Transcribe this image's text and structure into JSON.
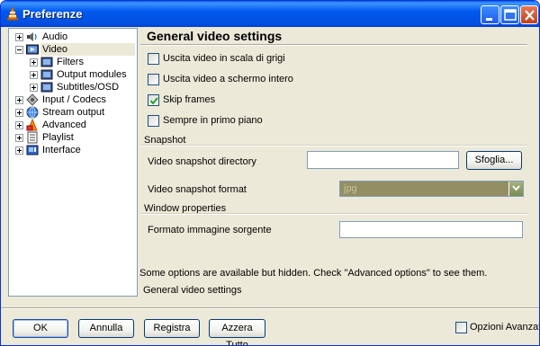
{
  "window": {
    "title": "Preferenze"
  },
  "tree": {
    "items": [
      {
        "label": "Audio",
        "icon": "speaker-icon",
        "expander": "plus"
      },
      {
        "label": "Video",
        "icon": "video-icon",
        "expander": "minus",
        "selected": true
      },
      {
        "label": "Filters",
        "icon": "film-icon",
        "expander": "plus",
        "child": true
      },
      {
        "label": "Output modules",
        "icon": "film-icon",
        "expander": "plus",
        "child": true
      },
      {
        "label": "Subtitles/OSD",
        "icon": "film-icon",
        "expander": "plus",
        "child": true
      },
      {
        "label": "Input / Codecs",
        "icon": "codecs-icon",
        "expander": "plus"
      },
      {
        "label": "Stream output",
        "icon": "stream-globe-icon",
        "expander": "plus"
      },
      {
        "label": "Advanced",
        "icon": "advanced-icon",
        "expander": "plus"
      },
      {
        "label": "Playlist",
        "icon": "playlist-icon",
        "expander": "plus"
      },
      {
        "label": "Interface",
        "icon": "interface-icon",
        "expander": "plus"
      }
    ]
  },
  "panel": {
    "title": "General video settings",
    "checkboxes": [
      {
        "label": "Uscita video in scala di grigi",
        "checked": false
      },
      {
        "label": "Uscita video a schermo intero",
        "checked": false
      },
      {
        "label": "Skip frames",
        "checked": true
      },
      {
        "label": "Sempre in primo piano",
        "checked": false
      }
    ],
    "snapshot": {
      "section": "Snapshot",
      "directory_label": "Video snapshot directory",
      "directory_value": "",
      "browse_label": "Sfoglia...",
      "format_label": "Video snapshot format",
      "format_value": "jpg"
    },
    "window_properties": {
      "section": "Window properties",
      "source_label": "Formato immagine sorgente",
      "source_value": ""
    },
    "hidden_hint": "Some options are available but hidden. Check \"Advanced options\" to see them.",
    "footer_title": "General video settings"
  },
  "buttons": {
    "ok": "OK",
    "cancel": "Annulla",
    "save": "Registra",
    "reset": "Azzera Tutto"
  },
  "advanced_options": {
    "label": "Opzioni Avanzate",
    "checked": false
  },
  "colors": {
    "titlebar": "#0058ee",
    "window_bg": "#ece9d8",
    "combo_bg": "#948e63"
  }
}
